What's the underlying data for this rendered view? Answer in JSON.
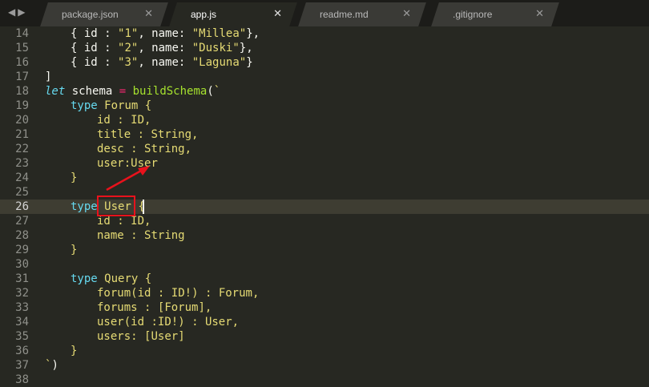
{
  "nav": {
    "back": "◀",
    "forward": "▶"
  },
  "tabs": [
    {
      "label": "package.json",
      "close": "✕",
      "active": false
    },
    {
      "label": "app.js",
      "close": "✕",
      "active": true
    },
    {
      "label": "readme.md",
      "close": "✕",
      "active": false
    },
    {
      "label": ".gitignore",
      "close": "✕",
      "active": false
    }
  ],
  "editor": {
    "current_line": "26",
    "lines": [
      {
        "num": "14",
        "text": "{ id : \"1\", name: \"Millea\"},"
      },
      {
        "num": "15",
        "text": "{ id : \"2\", name: \"Duski\"},"
      },
      {
        "num": "16",
        "text": "{ id : \"3\", name: \"Laguna\"}"
      },
      {
        "num": "17",
        "text": "]"
      },
      {
        "num": "18",
        "text": "let schema = buildSchema(`"
      },
      {
        "num": "19",
        "text": "type Forum {"
      },
      {
        "num": "20",
        "text": "id : ID,"
      },
      {
        "num": "21",
        "text": "title : String,"
      },
      {
        "num": "22",
        "text": "desc : String,"
      },
      {
        "num": "23",
        "text": "user:User"
      },
      {
        "num": "24",
        "text": "}"
      },
      {
        "num": "25",
        "text": ""
      },
      {
        "num": "26",
        "text": "type User {"
      },
      {
        "num": "27",
        "text": "id : ID,"
      },
      {
        "num": "28",
        "text": "name : String"
      },
      {
        "num": "29",
        "text": "}"
      },
      {
        "num": "30",
        "text": ""
      },
      {
        "num": "31",
        "text": "type Query {"
      },
      {
        "num": "32",
        "text": "forum(id : ID!) : Forum,"
      },
      {
        "num": "33",
        "text": "forums : [Forum],"
      },
      {
        "num": "34",
        "text": "user(id :ID!) : User,"
      },
      {
        "num": "35",
        "text": "users: [User]"
      },
      {
        "num": "36",
        "text": "}"
      },
      {
        "num": "37",
        "text": "`)"
      },
      {
        "num": "38",
        "text": ""
      }
    ]
  },
  "annotation_color": "#e8121c"
}
